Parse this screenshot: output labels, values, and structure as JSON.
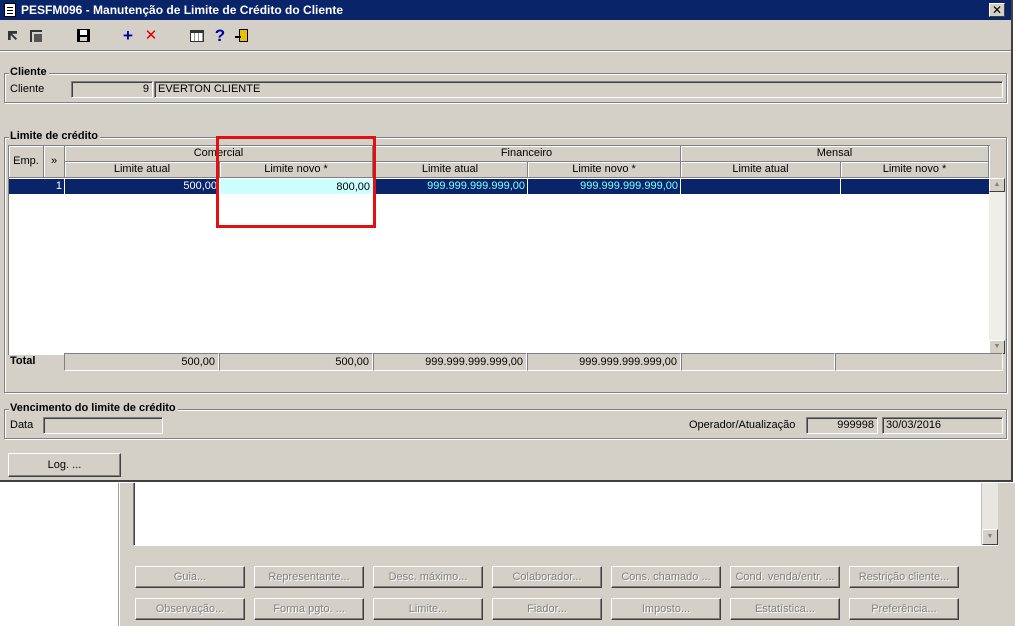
{
  "window": {
    "title": "PESFM096 - Manutenção de Limite de Crédito do Cliente",
    "close_glyph": "✕"
  },
  "toolbar": {
    "plus_glyph": "+",
    "x_glyph": "✕",
    "help_glyph": "?"
  },
  "cliente": {
    "group_title": "Cliente",
    "label": "Cliente",
    "code": "9",
    "name": "EVERTON CLIENTE"
  },
  "limite": {
    "group_title": "Limite de crédito",
    "headers": {
      "emp": "Emp.",
      "expand": "»",
      "comercial": "Comercial",
      "financeiro": "Financeiro",
      "mensal": "Mensal",
      "limite_atual": "Limite atual",
      "limite_novo": "Limite novo *"
    },
    "rows": [
      {
        "emp": "1",
        "comercial_atual": "500,00",
        "comercial_novo": "800,00",
        "financeiro_atual": "999.999.999.999,00",
        "financeiro_novo": "999.999.999.999,00",
        "mensal_atual": "",
        "mensal_novo": ""
      }
    ],
    "total": {
      "label": "Total",
      "comercial_atual": "500,00",
      "comercial_novo": "500,00",
      "financeiro_atual": "999.999.999.999,00",
      "financeiro_novo": "999.999.999.999,00",
      "mensal_atual": "",
      "mensal_novo": ""
    },
    "scroll_up": "▲",
    "scroll_down": "▼"
  },
  "vencimento": {
    "group_title": "Vencimento do limite de crédito",
    "data_label": "Data",
    "data_value": "",
    "operador_label": "Operador/Atualização",
    "operador_value": "999998",
    "atualizacao_value": "30/03/2016"
  },
  "buttons": {
    "log": "Log. ..."
  },
  "background": {
    "scroll_down": "▼",
    "buttons_row1": [
      "Guia...",
      "Representante...",
      "Desc. máximo...",
      "Colaborador...",
      "Cons. chamado ...",
      "Cond. venda/entr. ...",
      "Restrição cliente..."
    ],
    "buttons_row2": [
      "Observação...",
      "Forma pgto. ...",
      "Limite...",
      "Fiador...",
      "Imposto...",
      "Estatística...",
      "Preferência..."
    ]
  }
}
